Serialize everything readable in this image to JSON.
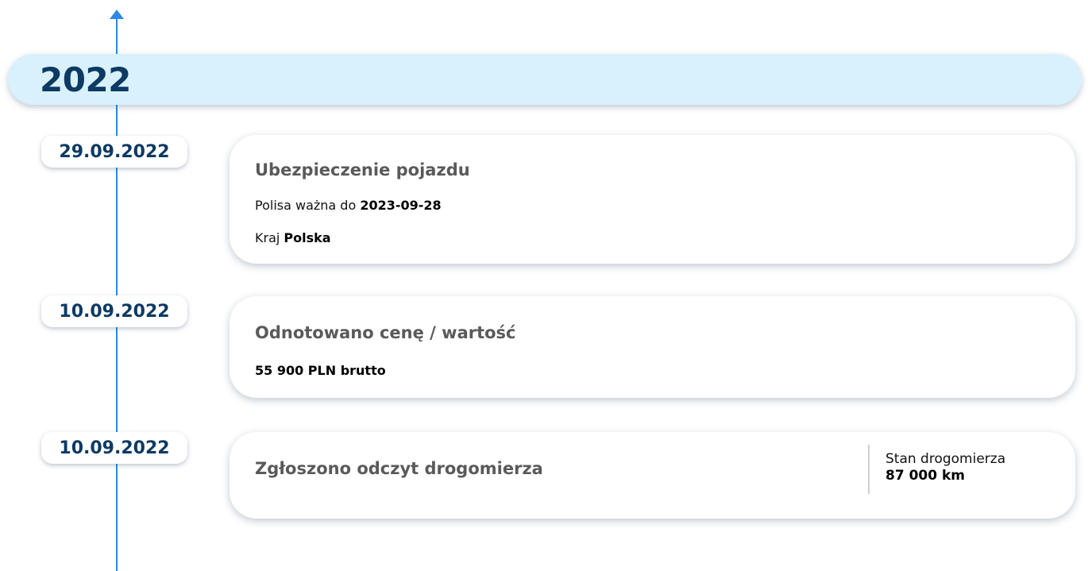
{
  "timeline": {
    "year": "2022",
    "events": [
      {
        "date": "29.09.2022",
        "title": "Ubezpieczenie pojazdu",
        "policy_label": "Polisa ważna do",
        "policy_value": "2023-09-28",
        "country_label": "Kraj",
        "country_value": "Polska"
      },
      {
        "date": "10.09.2022",
        "title": "Odnotowano cenę / wartość",
        "price": "55 900 PLN brutto"
      },
      {
        "date": "10.09.2022",
        "title": "Zgłoszono odczyt drogomierza",
        "odometer_label": "Stan drogomierza",
        "odometer_value": "87 000 km"
      }
    ]
  },
  "colors": {
    "axis": "#2d8ae0",
    "year_band": "#d9f1fd",
    "date_text": "#0c3a63",
    "card_title": "#5a5a5a"
  }
}
